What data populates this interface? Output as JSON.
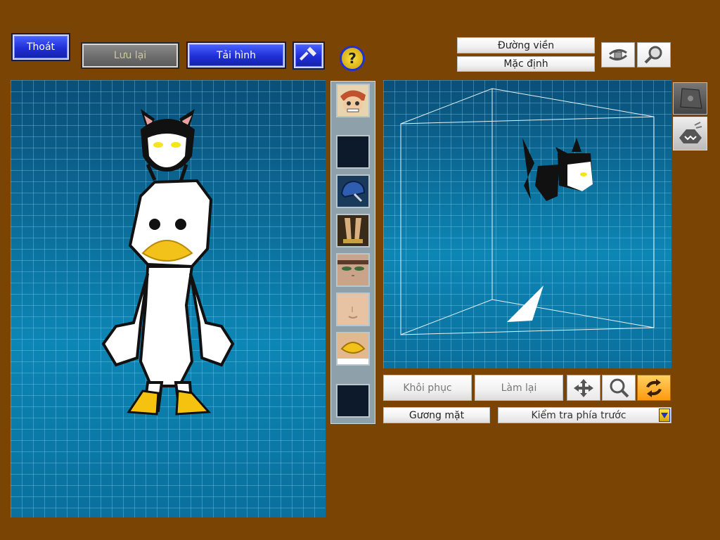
{
  "toolbar": {
    "exit_label": "Thoát",
    "save_label": "Lưu lại",
    "load_label": "Tải hình"
  },
  "view_options": {
    "outline_label": "Đường viền",
    "default_label": "Mặc định"
  },
  "controls": {
    "restore_label": "Khôi phục",
    "redo_label": "Làm lại",
    "category_label": "Gương mặt",
    "view_select_value": "Kiểm tra phía trước"
  },
  "icons": {
    "hammer": "hammer-icon",
    "help": "help-icon",
    "rotate": "rotate-view-icon",
    "zoom": "zoom-view-icon",
    "move": "move-icon",
    "magnify": "magnify-icon",
    "refresh": "refresh-icon",
    "dropdown": "chevron-down-icon"
  },
  "colors": {
    "background": "#7a4405",
    "grid_blue": "#0a6f9c",
    "button_blue": "#1f2fd6",
    "active_orange": "#ffb020"
  }
}
